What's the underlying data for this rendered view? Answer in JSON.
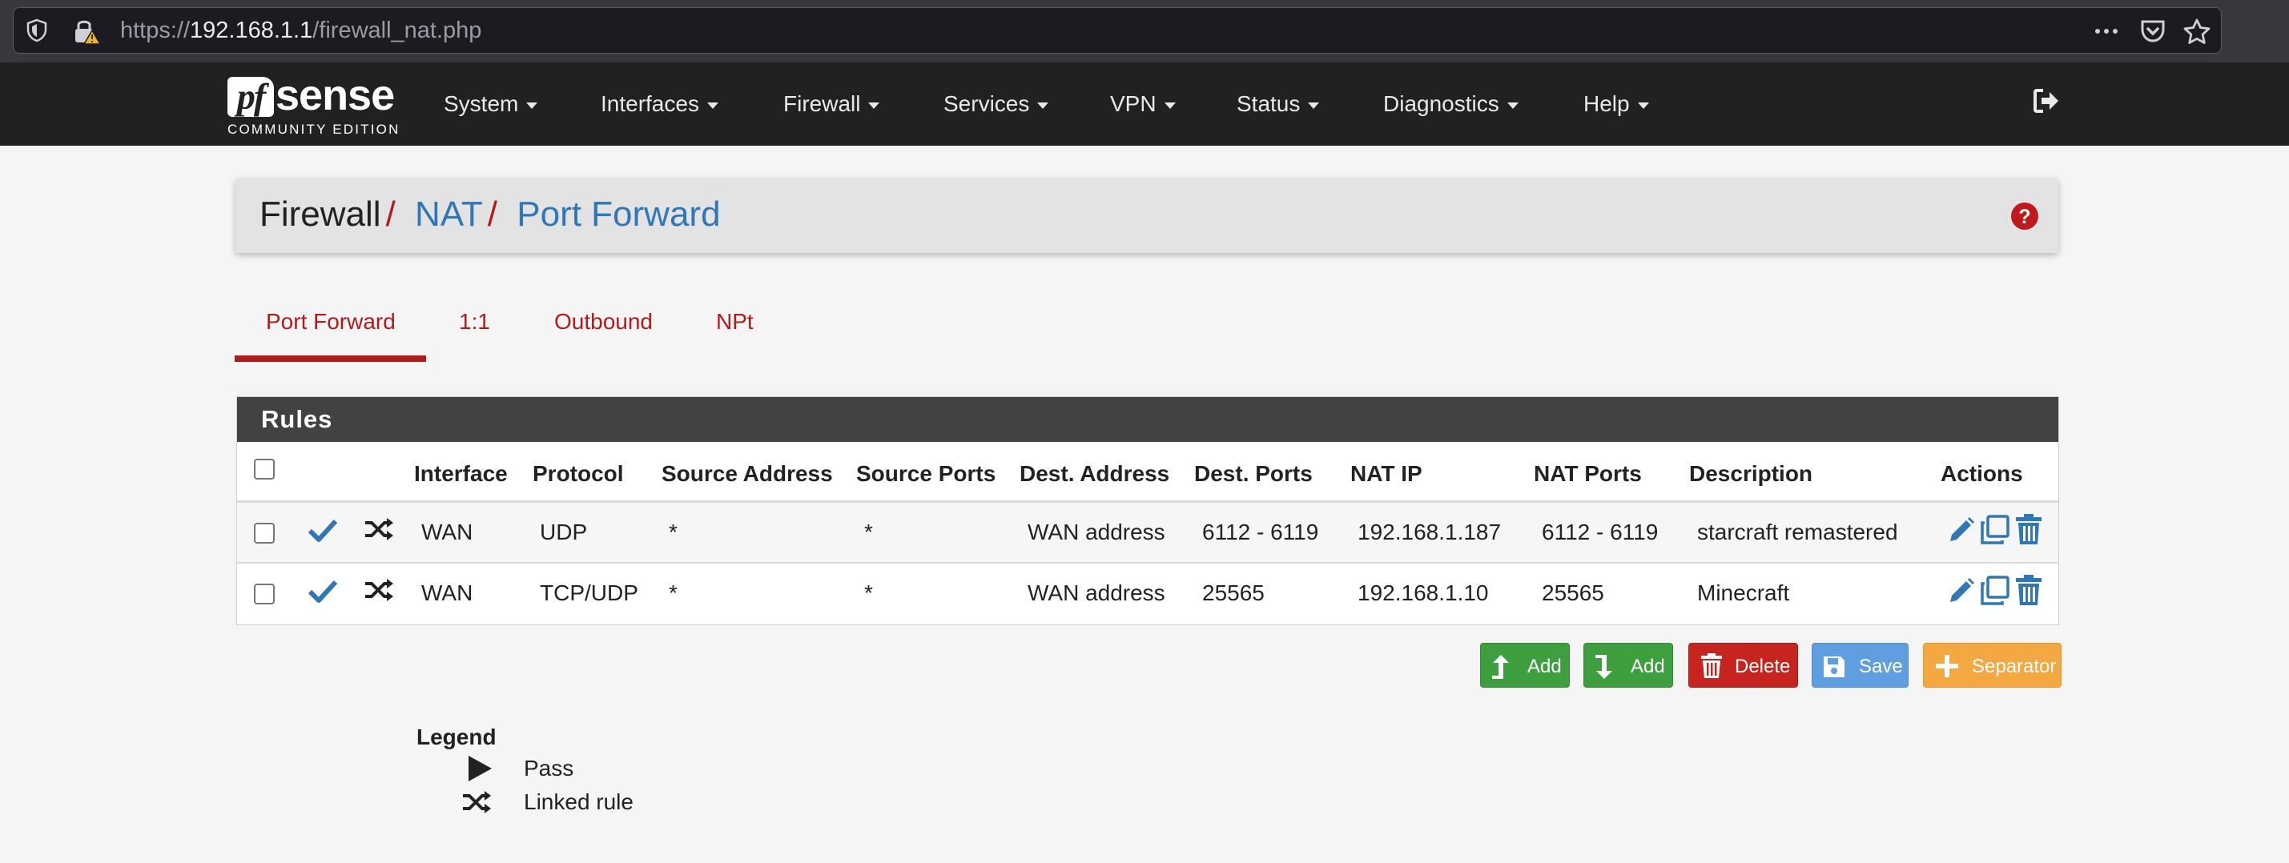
{
  "browser": {
    "url_scheme": "https://",
    "url_host": "192.168.1.1",
    "url_path": "/firewall_nat.php",
    "icons": [
      "shield-icon",
      "insecure-lock-icon",
      "more-icon",
      "pocket-icon",
      "bookmark-star-icon"
    ]
  },
  "navbar": {
    "logo_pf": "pf",
    "logo_sense": "sense",
    "logo_edition": "COMMUNITY EDITION",
    "menu": [
      "System",
      "Interfaces",
      "Firewall",
      "Services",
      "VPN",
      "Status",
      "Diagnostics",
      "Help"
    ]
  },
  "breadcrumb": {
    "first": "Firewall",
    "second": "NAT",
    "third": "Port Forward",
    "separator": "/"
  },
  "tabs": [
    "Port Forward",
    "1:1",
    "Outbound",
    "NPt"
  ],
  "active_tab": "Port Forward",
  "rules": {
    "title": "Rules",
    "columns": [
      "Interface",
      "Protocol",
      "Source Address",
      "Source Ports",
      "Dest. Address",
      "Dest. Ports",
      "NAT IP",
      "NAT Ports",
      "Description",
      "Actions"
    ],
    "rows": [
      {
        "interface": "WAN",
        "protocol": "UDP",
        "source_address": "*",
        "source_ports": "*",
        "dest_address": "WAN address",
        "dest_ports": "6112 - 6119",
        "nat_ip": "192.168.1.187",
        "nat_ports": "6112 - 6119",
        "description": "starcraft remastered"
      },
      {
        "interface": "WAN",
        "protocol": "TCP/UDP",
        "source_address": "*",
        "source_ports": "*",
        "dest_address": "WAN address",
        "dest_ports": "25565",
        "nat_ip": "192.168.1.10",
        "nat_ports": "25565",
        "description": "Minecraft"
      }
    ]
  },
  "buttons": {
    "add_top": "Add",
    "add_bottom": "Add",
    "delete": "Delete",
    "save": "Save",
    "separator": "Separator"
  },
  "legend": {
    "title": "Legend",
    "pass": "Pass",
    "linked": "Linked rule"
  },
  "colors": {
    "navbar": "#212121",
    "accent_red": "#b31b1b",
    "link_blue": "#2f77b7",
    "btn_green": "#3e9f3e",
    "btn_red": "#c6251f",
    "btn_blue": "#5f9fe0",
    "btn_orange": "#f3a842"
  }
}
